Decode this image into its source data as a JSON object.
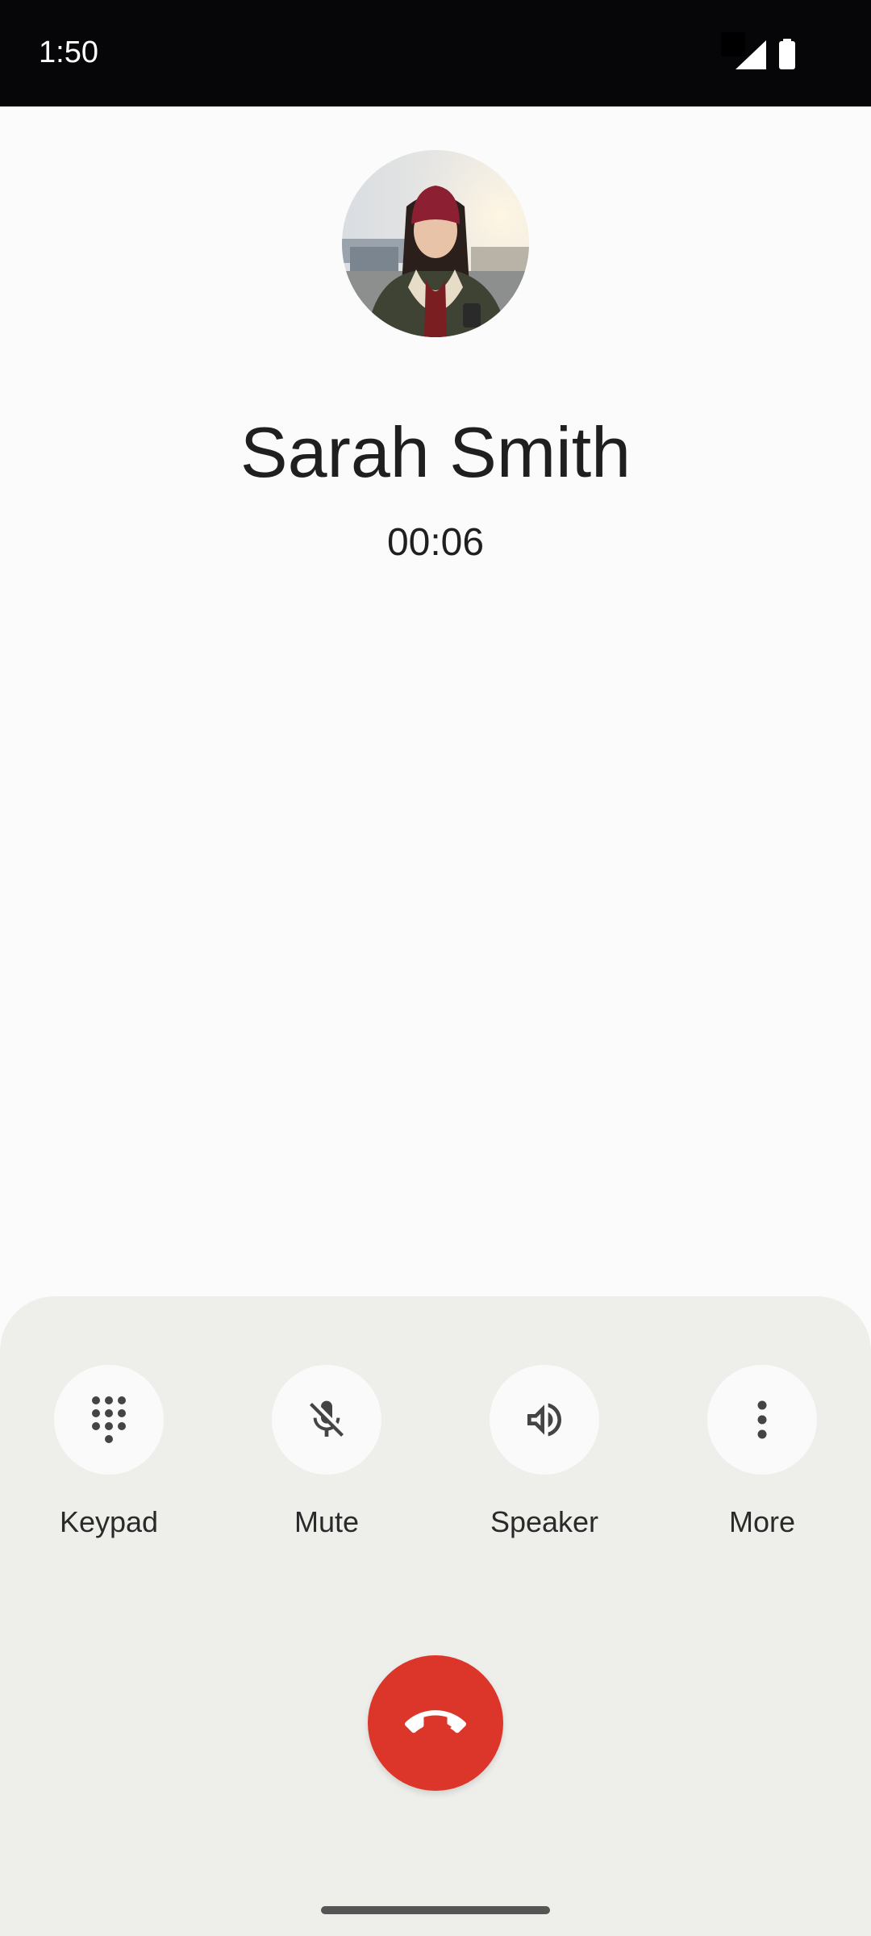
{
  "status_bar": {
    "time": "1:50",
    "icons": [
      "wifi-icon",
      "signal-icon",
      "battery-icon"
    ]
  },
  "call": {
    "caller_name": "Sarah Smith",
    "duration": "00:06"
  },
  "controls": [
    {
      "label": "Keypad",
      "icon": "dialpad-icon"
    },
    {
      "label": "Mute",
      "icon": "mic-off-icon"
    },
    {
      "label": "Speaker",
      "icon": "speaker-icon"
    },
    {
      "label": "More",
      "icon": "more-vertical-icon"
    }
  ],
  "end_call": {
    "icon": "call-end-icon"
  },
  "colors": {
    "status_bar_bg": "#060608",
    "screen_bg": "#fbfbfb",
    "panel_bg": "#eeeeea",
    "end_call_red": "#dc352a",
    "text": "#1f1f1f"
  }
}
